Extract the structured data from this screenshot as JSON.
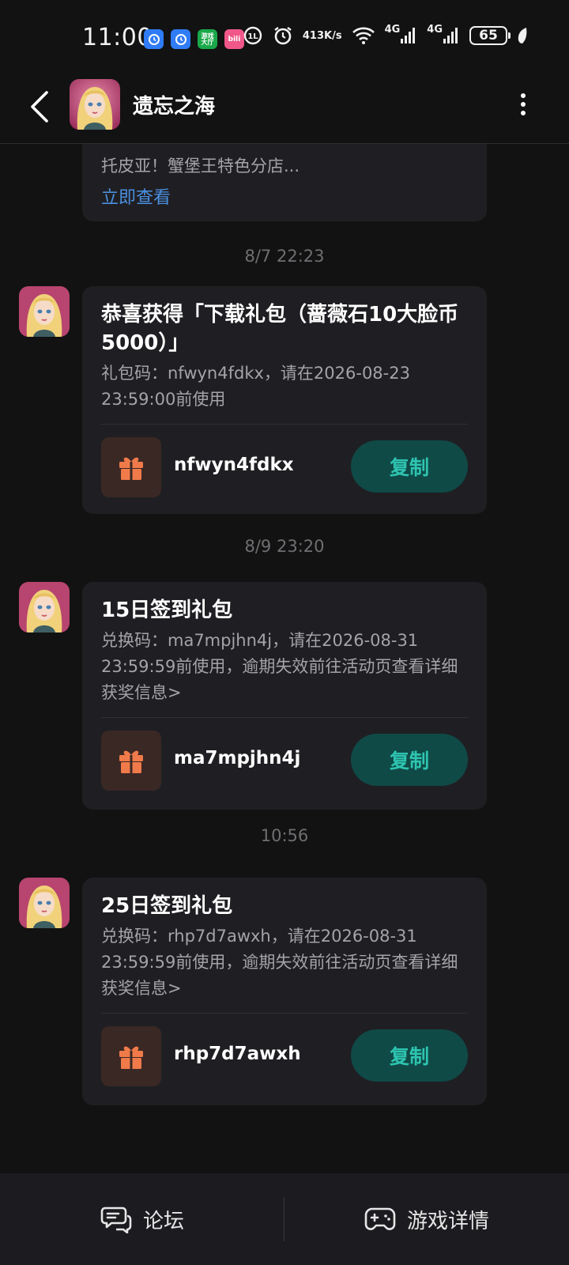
{
  "status_bar": {
    "time": "11:00",
    "notif_icons": [
      {
        "name": "clock-app-icon",
        "color": "#2f7cf6",
        "label": ""
      },
      {
        "name": "clock-app-icon",
        "color": "#2f7cf6",
        "label": ""
      },
      {
        "name": "game-center-icon",
        "color": "#1aa84a",
        "label": "游戏\n大厅"
      },
      {
        "name": "bilibili-icon",
        "color": "#f0588a",
        "label": "bili"
      }
    ],
    "net_speed_top": "413",
    "net_speed_bottom": "K/s",
    "signal1": "4G",
    "signal2": "4G",
    "battery": "65"
  },
  "header": {
    "title": "遗忘之海"
  },
  "messages": [
    {
      "type": "partial",
      "desc": "托皮亚！蟹堡王特色分店...",
      "link": "立即查看"
    },
    {
      "timestamp": "8/7  22:23",
      "title": "恭喜获得「下载礼包（蔷薇石10大脸币5000）」",
      "desc": "礼包码：nfwyn4fdkx，请在2026-08-23 23:59:00前使用",
      "code": "nfwyn4fdkx",
      "copy_label": "复制"
    },
    {
      "timestamp": "8/9  23:20",
      "title": "15日签到礼包",
      "desc": "兑换码：ma7mpjhn4j，请在2026-08-31 23:59:59前使用，逾期失效前往活动页查看详细获奖信息>",
      "code": "ma7mpjhn4j",
      "copy_label": "复制"
    },
    {
      "timestamp": "10:56",
      "title": "25日签到礼包",
      "desc": "兑换码：rhp7d7awxh，请在2026-08-31 23:59:59前使用，逾期失效前往活动页查看详细获奖信息>",
      "code": "rhp7d7awxh",
      "copy_label": "复制"
    }
  ],
  "bottom_bar": {
    "forum_label": "论坛",
    "game_detail_label": "游戏详情"
  },
  "colors": {
    "background": "#121212",
    "card": "#1f1f23",
    "link": "#4a8fe0",
    "copy_button_bg": "#0f4a47",
    "copy_button_text": "#2ec4b0",
    "gift_icon": "#f07a4a"
  }
}
